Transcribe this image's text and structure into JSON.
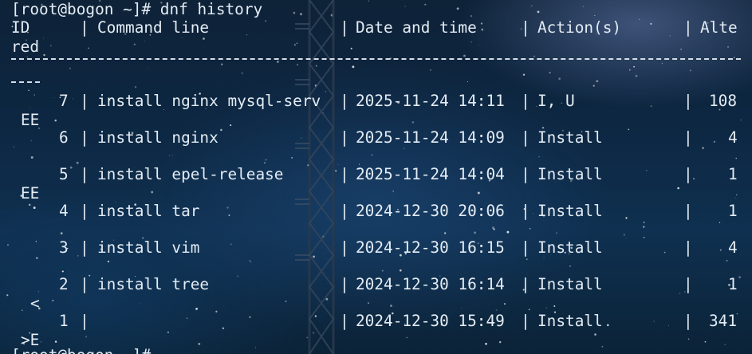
{
  "prompt": "[root@bogon ~]# dnf history",
  "headers": {
    "id": "ID",
    "command_line": "Command line",
    "date_time": "Date and time",
    "actions": "Action(s)",
    "altered_part1": "Alte",
    "altered_part2": "red"
  },
  "rows": [
    {
      "id": "7",
      "command": "install nginx mysql-serv",
      "date": "2025-11-24 14:11",
      "action": "I, U",
      "altered": "108",
      "overflow": "EE"
    },
    {
      "id": "6",
      "command": "install nginx",
      "date": "2025-11-24 14:09",
      "action": "Install",
      "altered": "4",
      "overflow": ""
    },
    {
      "id": "5",
      "command": "install epel-release",
      "date": "2025-11-24 14:04",
      "action": "Install",
      "altered": "1",
      "overflow": "EE"
    },
    {
      "id": "4",
      "command": "install tar",
      "date": "2024-12-30 20:06",
      "action": "Install",
      "altered": "1",
      "overflow": ""
    },
    {
      "id": "3",
      "command": "install vim",
      "date": "2024-12-30 16:15",
      "action": "Install",
      "altered": "4",
      "overflow": ""
    },
    {
      "id": "2",
      "command": "install tree",
      "date": "2024-12-30 16:14",
      "action": "Install",
      "altered": "1",
      "overflow": "<"
    },
    {
      "id": "1",
      "command": "",
      "date": "2024-12-30 15:49",
      "action": "Install",
      "altered": "341",
      "overflow": ">E"
    }
  ],
  "next_prompt": "[root@bogon ~]#",
  "colors": {
    "text": "#e4ecf4",
    "background": "#0d2742"
  }
}
